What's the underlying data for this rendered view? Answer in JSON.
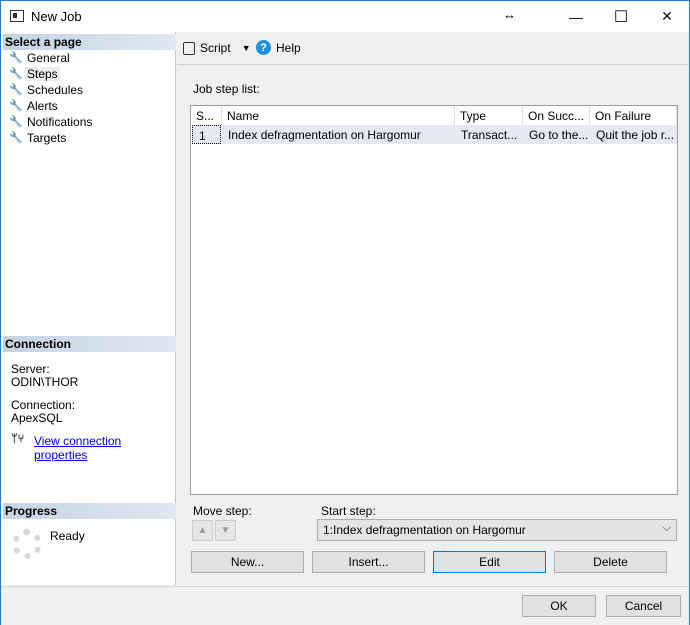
{
  "window": {
    "title": "New Job",
    "resize_glyph": "↔",
    "min": "—",
    "max": "☐",
    "close": "✕"
  },
  "sidebar": {
    "select_header": "Select a page",
    "items": [
      {
        "label": "General"
      },
      {
        "label": "Steps"
      },
      {
        "label": "Schedules"
      },
      {
        "label": "Alerts"
      },
      {
        "label": "Notifications"
      },
      {
        "label": "Targets"
      }
    ],
    "connection_header": "Connection",
    "server_label": "Server:",
    "server_value": "ODIN\\THOR",
    "connection_label": "Connection:",
    "connection_value": "ApexSQL",
    "view_link": "View connection properties",
    "progress_header": "Progress",
    "progress_status": "Ready"
  },
  "toolbar": {
    "script": "Script",
    "help": "Help"
  },
  "main": {
    "list_label": "Job step list:",
    "columns": [
      "S...",
      "Name",
      "Type",
      "On Succ...",
      "On Failure"
    ],
    "rows": [
      [
        "1",
        "Index defragmentation on Hargomur",
        "Transact...",
        "Go to the...",
        "Quit the job r..."
      ]
    ],
    "move_step_label": "Move step:",
    "start_step_label": "Start step:",
    "start_step_value": "1:Index defragmentation on Hargomur",
    "buttons": {
      "new": "New...",
      "insert": "Insert...",
      "edit": "Edit",
      "delete": "Delete"
    }
  },
  "footer": {
    "ok": "OK",
    "cancel": "Cancel"
  }
}
